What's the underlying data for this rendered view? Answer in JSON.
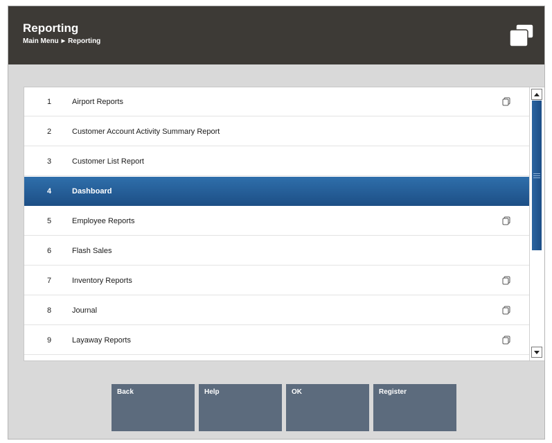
{
  "header": {
    "title": "Reporting",
    "breadcrumb": {
      "root": "Main Menu",
      "separator": "▶",
      "current": "Reporting"
    },
    "icon": "window-stack-icon"
  },
  "menu": {
    "selected_index": 3,
    "items": [
      {
        "number": "1",
        "label": "Airport Reports",
        "icon": "submenu-icon"
      },
      {
        "number": "2",
        "label": "Customer Account Activity Summary Report",
        "icon": ""
      },
      {
        "number": "3",
        "label": "Customer List Report",
        "icon": ""
      },
      {
        "number": "4",
        "label": "Dashboard",
        "icon": ""
      },
      {
        "number": "5",
        "label": "Employee Reports",
        "icon": "submenu-icon"
      },
      {
        "number": "6",
        "label": "Flash Sales",
        "icon": ""
      },
      {
        "number": "7",
        "label": "Inventory Reports",
        "icon": "submenu-icon"
      },
      {
        "number": "8",
        "label": "Journal",
        "icon": "submenu-icon"
      },
      {
        "number": "9",
        "label": "Layaway Reports",
        "icon": "submenu-icon"
      }
    ]
  },
  "scrollbar": {
    "up_icon": "arrow-up-icon",
    "down_icon": "arrow-down-icon"
  },
  "buttons": {
    "back": "Back",
    "help": "Help",
    "ok": "OK",
    "register": "Register"
  },
  "colors": {
    "header_bg": "#3d3a36",
    "selected_row": "#1d4f86",
    "button_bg": "#5c6b7d",
    "page_bg": "#d9d9d9"
  }
}
